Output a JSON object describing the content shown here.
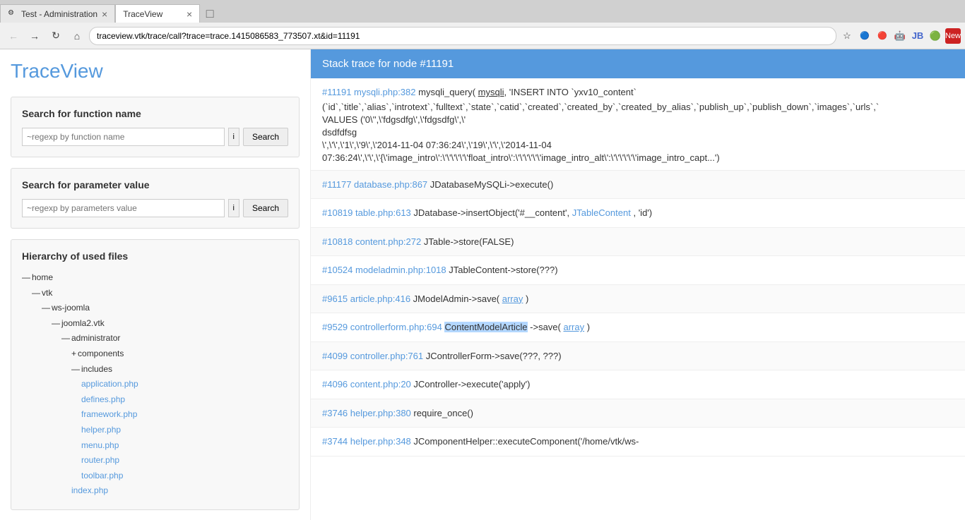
{
  "browser": {
    "tabs": [
      {
        "id": "tab-test-admin",
        "title": "Test - Administration",
        "active": false,
        "favicon": "⚙"
      },
      {
        "id": "tab-traceview",
        "title": "TraceView",
        "active": true,
        "favicon": ""
      }
    ],
    "url": "traceview.vtk/trace/call?trace=trace.1415086583_773507.xt&id=11191",
    "new_tab_icon": "+"
  },
  "page": {
    "title": "TraceView"
  },
  "left": {
    "search_function": {
      "title": "Search for function name",
      "input_placeholder": "~regexp by function name",
      "flag_label": "i",
      "button_label": "Search"
    },
    "search_param": {
      "title": "Search for parameter value",
      "input_placeholder": "~regexp by parameters value",
      "flag_label": "i",
      "button_label": "Search"
    },
    "hierarchy": {
      "title": "Hierarchy of used files",
      "tree": [
        {
          "level": 0,
          "icon": "minus",
          "text": "home",
          "link": false
        },
        {
          "level": 1,
          "icon": "minus",
          "text": "vtk",
          "link": false
        },
        {
          "level": 2,
          "icon": "minus",
          "text": "ws-joomla",
          "link": false
        },
        {
          "level": 3,
          "icon": "minus",
          "text": "joomla2.vtk",
          "link": false
        },
        {
          "level": 4,
          "icon": "minus",
          "text": "administrator",
          "link": false
        },
        {
          "level": 5,
          "icon": "plus",
          "text": "components",
          "link": false
        },
        {
          "level": 5,
          "icon": "minus",
          "text": "includes",
          "link": false
        },
        {
          "level": 6,
          "icon": "none",
          "text": "application.php",
          "link": true
        },
        {
          "level": 6,
          "icon": "none",
          "text": "defines.php",
          "link": true
        },
        {
          "level": 6,
          "icon": "none",
          "text": "framework.php",
          "link": true
        },
        {
          "level": 6,
          "icon": "none",
          "text": "helper.php",
          "link": true
        },
        {
          "level": 6,
          "icon": "none",
          "text": "menu.php",
          "link": true
        },
        {
          "level": 6,
          "icon": "none",
          "text": "router.php",
          "link": true
        },
        {
          "level": 6,
          "icon": "none",
          "text": "toolbar.php",
          "link": true
        },
        {
          "level": 5,
          "icon": "none",
          "text": "index.php",
          "link": true
        }
      ]
    }
  },
  "right": {
    "stack_header": "Stack trace for node #11191",
    "entries": [
      {
        "id": "entry-11191",
        "link_text": "#11191 mysqli.php:382",
        "text": "mysqli_query( mysqli, 'INSERT INTO `yxv10_content`",
        "continuation": "(`id`,`title`,`alias`,`introtext`,`fulltext`,`state`,`catid`,`created`,`created_by`,`created_by_alias`,`publish_up`,`publish_down`,`images`,`urls`,`\nVALUES ('0\\'',\\'fdgsdfg\\',\\'fdgsdfg\\',\\'",
        "line3": "dsdfdfsg",
        "line4": "\\',\\'\\',\\'1\\',\\'9\\',\\'2014-11-04 07:36:24\\',\\'19\\',\\'\\',\\'2014-11-04",
        "line5": "07:36:24\\',\\'\\',\\'{\\'image_intro\\':\\'\\'\\'\\',\\'float_intro\\':\\'\\'\\'\\',\\'image_intro_alt\\':\\'\\'\\'\\',\\'image_intro_capt...')"
      },
      {
        "id": "entry-11177",
        "link_text": "#11177 database.php:867",
        "text": "JDatabaseMySQLi->execute()"
      },
      {
        "id": "entry-10819",
        "link_text": "#10819 table.php:613",
        "text": "JDatabase->insertObject('#__content', ",
        "text_link": "JTableContent",
        "text_after": ", 'id')"
      },
      {
        "id": "entry-10818",
        "link_text": "#10818 content.php:272",
        "text": "JTable->store(FALSE)"
      },
      {
        "id": "entry-10524",
        "link_text": "#10524 modeladmin.php:1018",
        "text": "JTableContent->store(???)"
      },
      {
        "id": "entry-9615",
        "link_text": "#9615 article.php:416",
        "text": "JModelAdmin->save( ",
        "text_link": "array",
        "text_after": ")"
      },
      {
        "id": "entry-9529",
        "link_text": "#9529 controllerform.php:694",
        "highlighted_text": "ContentModelArticle",
        "text": "->save( ",
        "text_link": "array",
        "text_after": ")"
      },
      {
        "id": "entry-4099",
        "link_text": "#4099 controller.php:761",
        "text": "JControllerForm->save(???, ???)"
      },
      {
        "id": "entry-4096",
        "link_text": "#4096 content.php:20",
        "text": "JController->execute('apply')"
      },
      {
        "id": "entry-3746",
        "link_text": "#3746 helper.php:380",
        "text": "require_once()"
      },
      {
        "id": "entry-3744",
        "link_text": "#3744 helper.php:348",
        "text": "JComponentHelper::executeComponent('/home/vtk/ws-"
      }
    ]
  }
}
